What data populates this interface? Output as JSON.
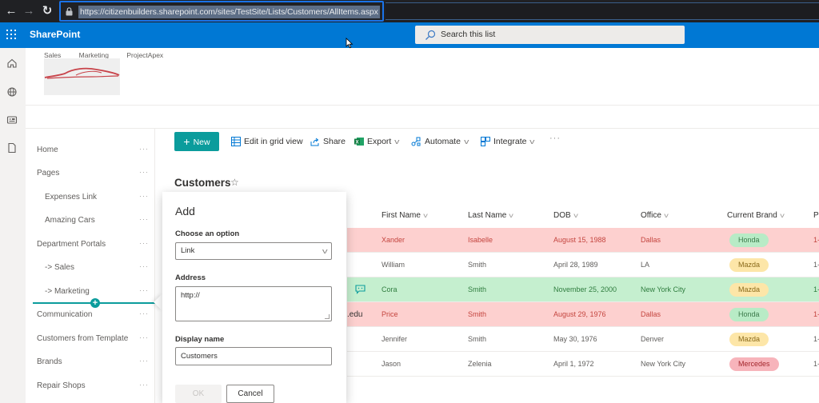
{
  "browser": {
    "back_icon": "arrow-left-icon",
    "forward_icon": "arrow-right-icon",
    "reload_icon": "reload-icon",
    "url": "https://citizenbuilders.sharepoint.com/sites/TestSite/Lists/Customers/AllItems.aspx"
  },
  "suite_bar": {
    "app_name": "SharePoint",
    "search_placeholder": "Search this list"
  },
  "app_rail": {
    "icons": [
      "home-icon",
      "globe-icon",
      "news-icon",
      "document-icon"
    ]
  },
  "site_header": {
    "nav_links": [
      "Sales",
      "Marketing",
      "ProjectApex"
    ],
    "logo": "car-logo"
  },
  "quick_launch": {
    "items": [
      {
        "label": "Home",
        "indent": false
      },
      {
        "label": "Pages",
        "indent": false
      },
      {
        "label": "Expenses Link",
        "indent": true
      },
      {
        "label": "Amazing Cars",
        "indent": true
      },
      {
        "label": "Department Portals",
        "indent": false
      },
      {
        "label": "-> Sales",
        "indent": true
      },
      {
        "label": "-> Marketing",
        "indent": true
      },
      {
        "label": "Communication",
        "indent": false
      },
      {
        "label": "Customers from Template",
        "indent": false
      },
      {
        "label": "Brands",
        "indent": false
      },
      {
        "label": "Repair Shops",
        "indent": false
      }
    ],
    "more_label": "···"
  },
  "command_bar": {
    "new_label": "New",
    "edit_grid_label": "Edit in grid view",
    "share_label": "Share",
    "export_label": "Export",
    "automate_label": "Automate",
    "integrate_label": "Integrate",
    "more_label": "···"
  },
  "list": {
    "title": "Customers",
    "star": "☆",
    "columns": [
      "First Name",
      "Last Name",
      "DOB",
      "Office",
      "Current Brand",
      "Ph"
    ],
    "partial_email_suffix": ".edu",
    "rows": [
      {
        "first": "Xander",
        "last": "Isabelle",
        "dob": "August 15, 1988",
        "office": "Dallas",
        "brand": "Honda",
        "phone": "1-",
        "color": "red"
      },
      {
        "first": "William",
        "last": "Smith",
        "dob": "April 28, 1989",
        "office": "LA",
        "brand": "Mazda",
        "phone": "1-",
        "color": "plain"
      },
      {
        "first": "Cora",
        "last": "Smith",
        "dob": "November 25, 2000",
        "office": "New York City",
        "brand": "Mazda",
        "phone": "1-",
        "color": "green"
      },
      {
        "first": "Price",
        "last": "Smith",
        "dob": "August 29, 1976",
        "office": "Dallas",
        "brand": "Honda",
        "phone": "1-",
        "color": "red"
      },
      {
        "first": "Jennifer",
        "last": "Smith",
        "dob": "May 30, 1976",
        "office": "Denver",
        "brand": "Mazda",
        "phone": "1-",
        "color": "plain"
      },
      {
        "first": "Jason",
        "last": "Zelenia",
        "dob": "April 1, 1972",
        "office": "New York City",
        "brand": "Mercedes",
        "phone": "1-",
        "color": "plain"
      }
    ]
  },
  "add_dialog": {
    "title": "Add",
    "option_label": "Choose an option",
    "option_value": "Link",
    "address_label": "Address",
    "address_value": "http://",
    "display_name_label": "Display name",
    "display_name_value": "Customers",
    "ok_label": "OK",
    "cancel_label": "Cancel"
  }
}
